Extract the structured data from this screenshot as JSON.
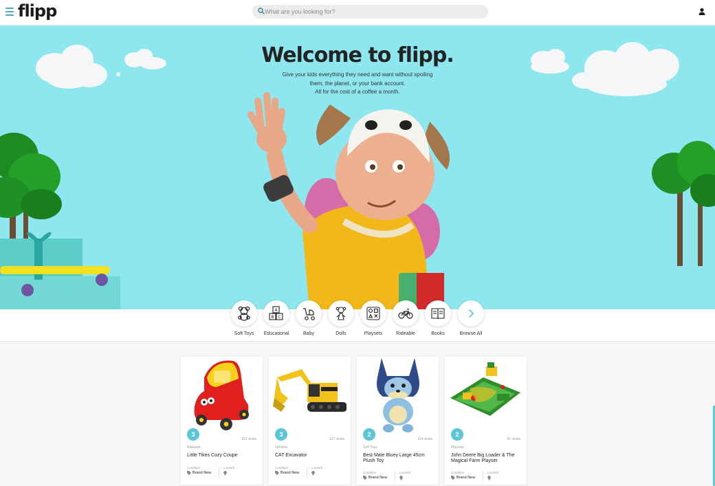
{
  "header": {
    "logo": "flipp",
    "search_placeholder": "What are you looking for?"
  },
  "hero": {
    "title": "Welcome to flipp.",
    "subtitle_lines": [
      "Give your kids everything they need and want without spoiling",
      "them, the planet, or your bank account.",
      "All for the cost of a coffee a month."
    ]
  },
  "categories": [
    {
      "label": "Soft Toys",
      "icon": "teddy-bear-icon"
    },
    {
      "label": "Educational",
      "icon": "abc-blocks-icon"
    },
    {
      "label": "Baby",
      "icon": "stroller-icon"
    },
    {
      "label": "Dolls",
      "icon": "doll-icon"
    },
    {
      "label": "Playsets",
      "icon": "playset-icon"
    },
    {
      "label": "Rideable",
      "icon": "bicycle-icon"
    },
    {
      "label": "Books",
      "icon": "book-icon"
    },
    {
      "label": "Browse All",
      "icon": "chevron-right-icon"
    }
  ],
  "products": [
    {
      "badge": "3",
      "views": "153 views",
      "category": "Rideable",
      "title": "Little Tikes Cozy Coupe",
      "condition_label": "Condition",
      "condition": "Brand New",
      "location_label": "Located"
    },
    {
      "badge": "3",
      "views": "127 views",
      "category": "Vehicles",
      "title": "CAT Excavator",
      "condition_label": "Condition",
      "condition": "Brand New",
      "location_label": "Located"
    },
    {
      "badge": "2",
      "views": "114 views",
      "category": "Soft Toys",
      "title": "Best Mate Bluey Large 45cm Plush Toy",
      "condition_label": "Condition",
      "condition": "Brand New",
      "location_label": "Located"
    },
    {
      "badge": "2",
      "views": "91 views",
      "category": "Playsets",
      "title": "John Deere Big Loader & The Magical Farm Playset",
      "condition_label": "Condition",
      "condition": "Brand New",
      "location_label": "Located"
    }
  ],
  "colors": {
    "accent": "#5cc5d8",
    "hero_bg": "#8ee6ee"
  }
}
